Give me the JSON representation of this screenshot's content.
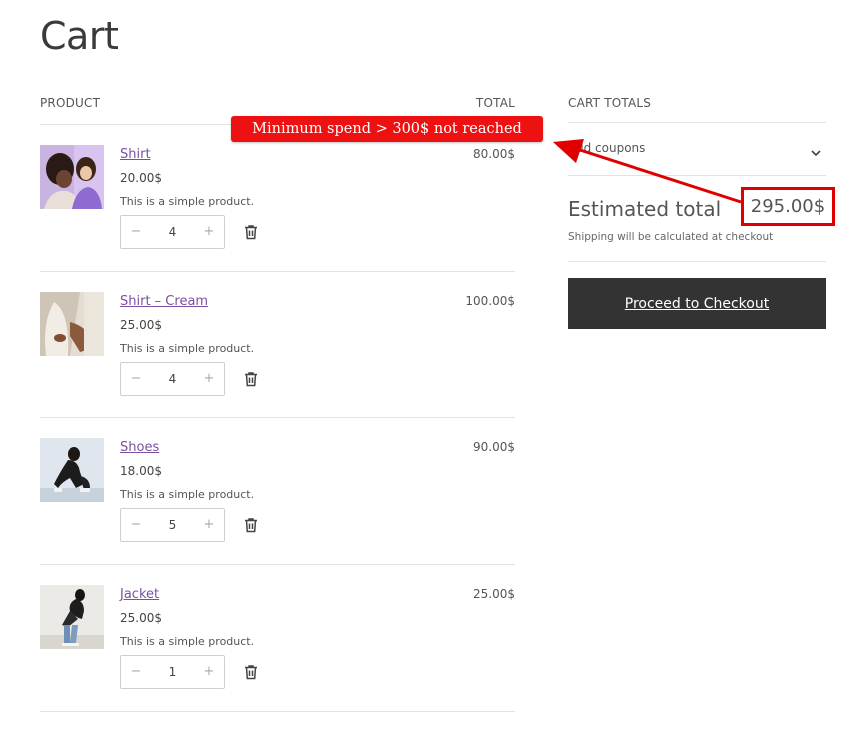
{
  "page": {
    "title": "Cart"
  },
  "table": {
    "product_header": "PRODUCT",
    "total_header": "TOTAL"
  },
  "items": [
    {
      "name": "Shirt",
      "price": "20.00$",
      "description": "This is a simple product.",
      "quantity": "4",
      "total": "80.00$"
    },
    {
      "name": "Shirt – Cream",
      "price": "25.00$",
      "description": "This is a simple product.",
      "quantity": "4",
      "total": "100.00$"
    },
    {
      "name": "Shoes",
      "price": "18.00$",
      "description": "This is a simple product.",
      "quantity": "5",
      "total": "90.00$"
    },
    {
      "name": "Jacket",
      "price": "25.00$",
      "description": "This is a simple product.",
      "quantity": "1",
      "total": "25.00$"
    }
  ],
  "qty_controls": {
    "minus": "−",
    "plus": "+"
  },
  "cart_totals": {
    "header": "CART TOTALS",
    "coupon_label": "Add coupons",
    "estimated_label": "Estimated total",
    "estimated_value": "295.00$",
    "shipping_note": "Shipping will be calculated at checkout",
    "checkout_label": "Proceed to Checkout"
  },
  "annotation": {
    "text": "Minimum spend > 300$ not reached",
    "color": "#ee1111"
  },
  "icons": {
    "remove": "trash-icon",
    "coupon_toggle": "chevron-down-icon"
  },
  "colors": {
    "link": "#7b4fa0",
    "button_bg": "#333333",
    "highlight": "#e00000"
  }
}
